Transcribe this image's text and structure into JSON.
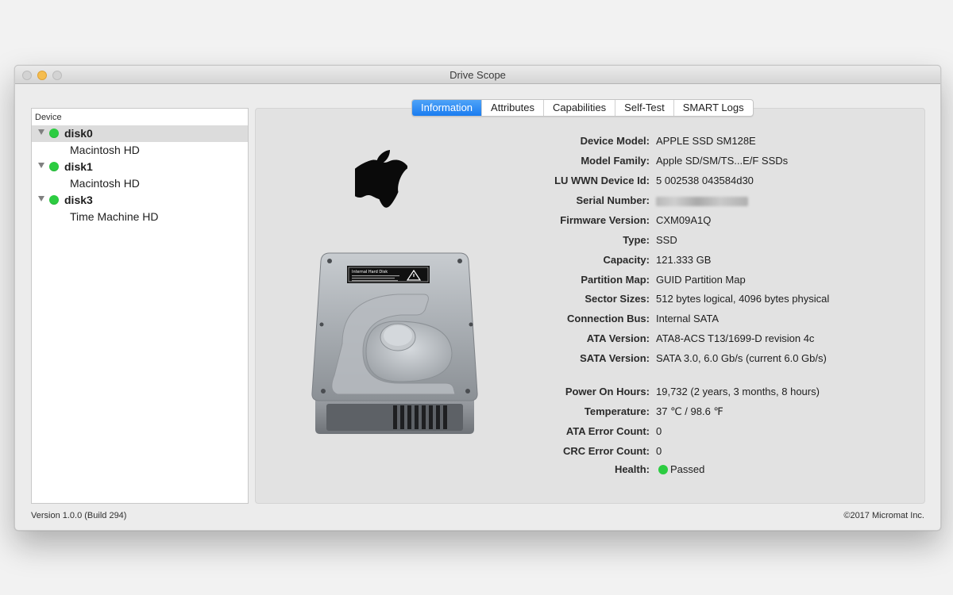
{
  "window": {
    "title": "Drive Scope"
  },
  "sidebar": {
    "header": "Device",
    "disks": [
      {
        "name": "disk0",
        "volume": "Macintosh HD",
        "status_color": "#2ccc41"
      },
      {
        "name": "disk1",
        "volume": "Macintosh HD",
        "status_color": "#2ccc41"
      },
      {
        "name": "disk3",
        "volume": "Time Machine HD",
        "status_color": "#2ccc41"
      }
    ],
    "selected_index": 0
  },
  "tabs": [
    {
      "label": "Information",
      "active": true
    },
    {
      "label": "Attributes",
      "active": false
    },
    {
      "label": "Capabilities",
      "active": false
    },
    {
      "label": "Self-Test",
      "active": false
    },
    {
      "label": "SMART Logs",
      "active": false
    }
  ],
  "info": {
    "device_model": {
      "label": "Device Model:",
      "value": "APPLE SSD SM128E"
    },
    "model_family": {
      "label": "Model Family:",
      "value": "Apple SD/SM/TS...E/F SSDs"
    },
    "lu_wwn": {
      "label": "LU WWN Device Id:",
      "value": "5 002538 043584d30"
    },
    "serial_number": {
      "label": "Serial Number:"
    },
    "firmware_version": {
      "label": "Firmware Version:",
      "value": "CXM09A1Q"
    },
    "type": {
      "label": "Type:",
      "value": "SSD"
    },
    "capacity": {
      "label": "Capacity:",
      "value": "121.333 GB"
    },
    "partition_map": {
      "label": "Partition Map:",
      "value": "GUID Partition Map"
    },
    "sector_sizes": {
      "label": "Sector Sizes:",
      "value": "512 bytes logical, 4096 bytes physical"
    },
    "connection_bus": {
      "label": "Connection Bus:",
      "value": "Internal SATA"
    },
    "ata_version": {
      "label": "ATA Version:",
      "value": "ATA8-ACS T13/1699-D revision 4c"
    },
    "sata_version": {
      "label": "SATA Version:",
      "value": "SATA 3.0, 6.0 Gb/s (current 6.0 Gb/s)"
    },
    "power_on_hours": {
      "label": "Power On Hours:",
      "value": "19,732 (2 years, 3 months, 8 hours)"
    },
    "temperature": {
      "label": "Temperature:",
      "value": "37 ℃ / 98.6 ℉"
    },
    "ata_error_count": {
      "label": "ATA Error Count:",
      "value": "0"
    },
    "crc_error_count": {
      "label": "CRC Error Count:",
      "value": "0"
    },
    "health": {
      "label": "Health:",
      "value": "Passed",
      "status_color": "#2ccc41"
    }
  },
  "drive_image": {
    "sticker_title": "Internal Hard Disk"
  },
  "footer": {
    "version": "Version 1.0.0 (Build 294)",
    "copyright": "©2017 Micromat Inc."
  },
  "icons": [
    "apple-logo-icon",
    "hard-drive-icon",
    "disclosure-triangle-icon",
    "status-dot-icon"
  ]
}
